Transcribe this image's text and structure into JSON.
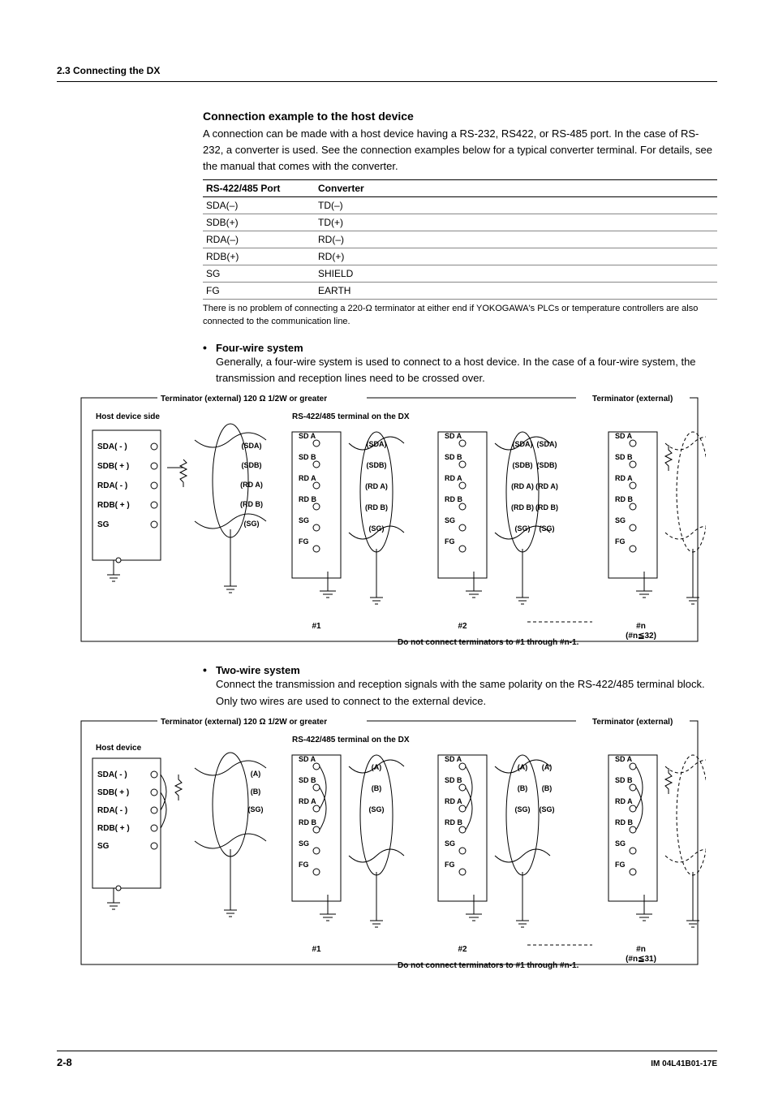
{
  "header": {
    "section": "2.3  Connecting the DX"
  },
  "conn": {
    "title": "Connection example to the host device",
    "p": "A connection can be made with a host device having a RS-232, RS422, or RS-485 port. In the case of RS-232, a converter is used. See the connection examples below for a typical converter terminal. For details, see the manual that comes with the converter.",
    "th1": "RS-422/485 Port",
    "th2": "Converter",
    "rows": [
      {
        "a": "SDA(–)",
        "b": "TD(–)"
      },
      {
        "a": "SDB(+)",
        "b": "TD(+)"
      },
      {
        "a": "RDA(–)",
        "b": "RD(–)"
      },
      {
        "a": "RDB(+)",
        "b": "RD(+)"
      },
      {
        "a": "SG",
        "b": "SHIELD"
      },
      {
        "a": "FG",
        "b": "EARTH"
      }
    ],
    "note": "There is no problem of connecting a 220-Ω terminator at either end if YOKOGAWA's PLCs or temperature controllers are also connected to the communication line."
  },
  "four": {
    "title": "Four-wire system",
    "p": "Generally, a four-wire system is used to connect to a host device. In the case of a four-wire system, the transmission and reception lines need to be crossed over.",
    "term_left": "Terminator (external) 120 Ω 1/2W or greater",
    "term_right": "Terminator (external)",
    "host": "Host device side",
    "block": "RS-422/485 terminal on the DX",
    "host_pins": [
      "SDA( - )",
      "SDB( + )",
      "RDA( - )",
      "RDB( + )",
      "SG"
    ],
    "wire_labels": [
      "(SDA)",
      "(SDB)",
      "(RD A)",
      "(RD B)",
      "(SG)"
    ],
    "dx_pins": [
      "SD  A",
      "SD  B",
      "RD  A",
      "RD  B",
      "SG",
      "FG"
    ],
    "units": [
      "#1",
      "#2",
      "#n"
    ],
    "count": "(#n≦32)",
    "warn": "Do not connect terminators to #1 through #n-1."
  },
  "two": {
    "title": "Two-wire system",
    "p": "Connect the transmission and reception signals with the same polarity on the RS-422/485 terminal block. Only two wires are used to connect to the external device.",
    "term_left": "Terminator (external) 120 Ω 1/2W or greater",
    "term_right": "Terminator (external)",
    "host": "Host device",
    "block": "RS-422/485 terminal on the DX",
    "host_pins": [
      "SDA( - )",
      "SDB( + )",
      "RDA( - )",
      "RDB( + )",
      "SG"
    ],
    "wire_labels": [
      "(A)",
      "(B)",
      "(SG)"
    ],
    "dx_pins": [
      "SD  A",
      "SD  B",
      "RD  A",
      "RD  B",
      "SG",
      "FG"
    ],
    "units": [
      "#1",
      "#2",
      "#n"
    ],
    "count": "(#n≦31)",
    "warn": "Do not connect terminators to #1 through #n-1."
  },
  "footer": {
    "page": "2-8",
    "doc": "IM 04L41B01-17E"
  }
}
